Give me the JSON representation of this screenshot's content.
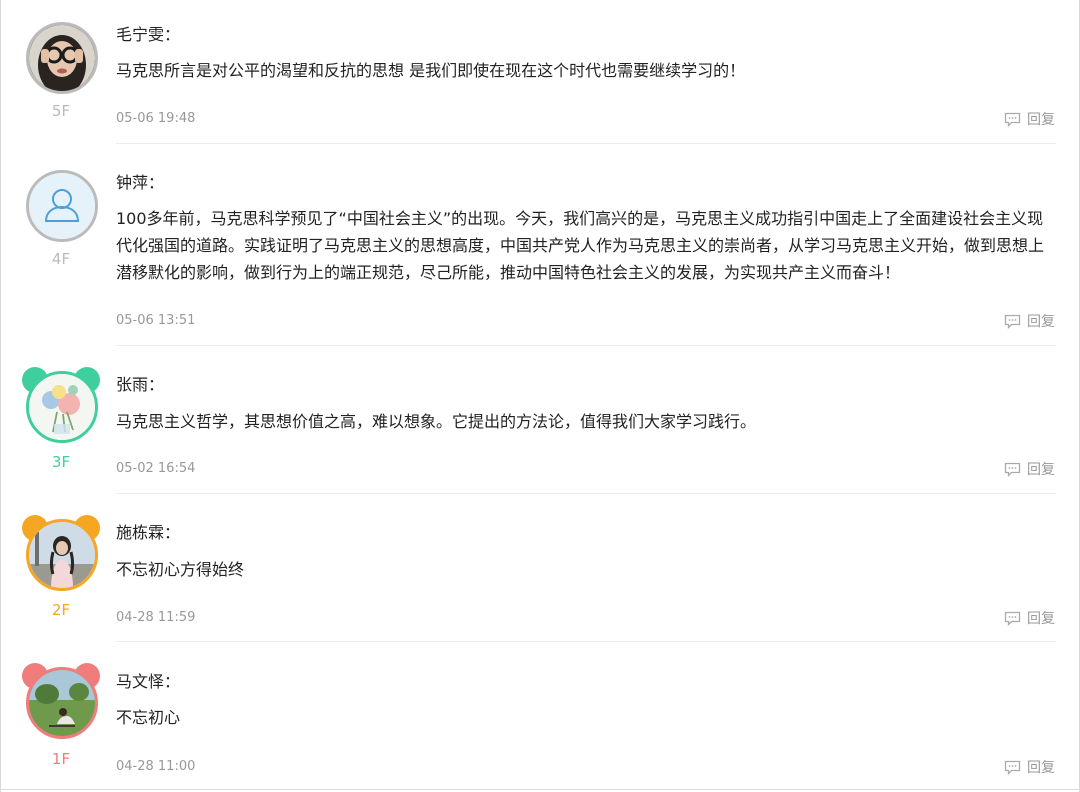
{
  "comments": [
    {
      "name": "毛宁雯：",
      "text": "马克思所言是对公平的渴望和反抗的思想 是我们即使在现在这个时代也需要继续学习的！",
      "date": "05-06 19:48",
      "floor": "5F",
      "reply": "回复",
      "accent": "#bbbbbb",
      "avatar": "person-photo-hands-over-eyes"
    },
    {
      "name": "钟萍：",
      "text": "100多年前，马克思科学预见了“中国社会主义”的出现。今天，我们高兴的是，马克思主义成功指引中国走上了全面建设社会主义现代化强国的道路。实践证明了马克思主义的思想高度，中国共产党人作为马克思主义的崇尚者，从学习马克思主义开始，做到思想上潜移默化的影响，做到行为上的端正规范，尽己所能，推动中国特色社会主义的发展，为实现共产主义而奋斗！",
      "date": "05-06 13:51",
      "floor": "4F",
      "reply": "回复",
      "accent": "#bbbbbb",
      "avatar": "default-user-icon"
    },
    {
      "name": "张雨：",
      "text": "马克思主义哲学，其思想价值之高，难以想象。它提出的方法论，值得我们大家学习践行。",
      "date": "05-02 16:54",
      "floor": "3F",
      "reply": "回复",
      "accent": "#3fcf9e",
      "avatar": "flower-bouquet-painting"
    },
    {
      "name": "施栋霖：",
      "text": "不忘初心方得始终",
      "date": "04-28 11:59",
      "floor": "2F",
      "reply": "回复",
      "accent": "#f5a623",
      "avatar": "woman-photo-outdoor"
    },
    {
      "name": "马文怿：",
      "text": "不忘初心",
      "date": "04-28 11:00",
      "floor": "1F",
      "reply": "回复",
      "accent": "#f07c7c",
      "avatar": "person-on-grass-photo"
    }
  ]
}
